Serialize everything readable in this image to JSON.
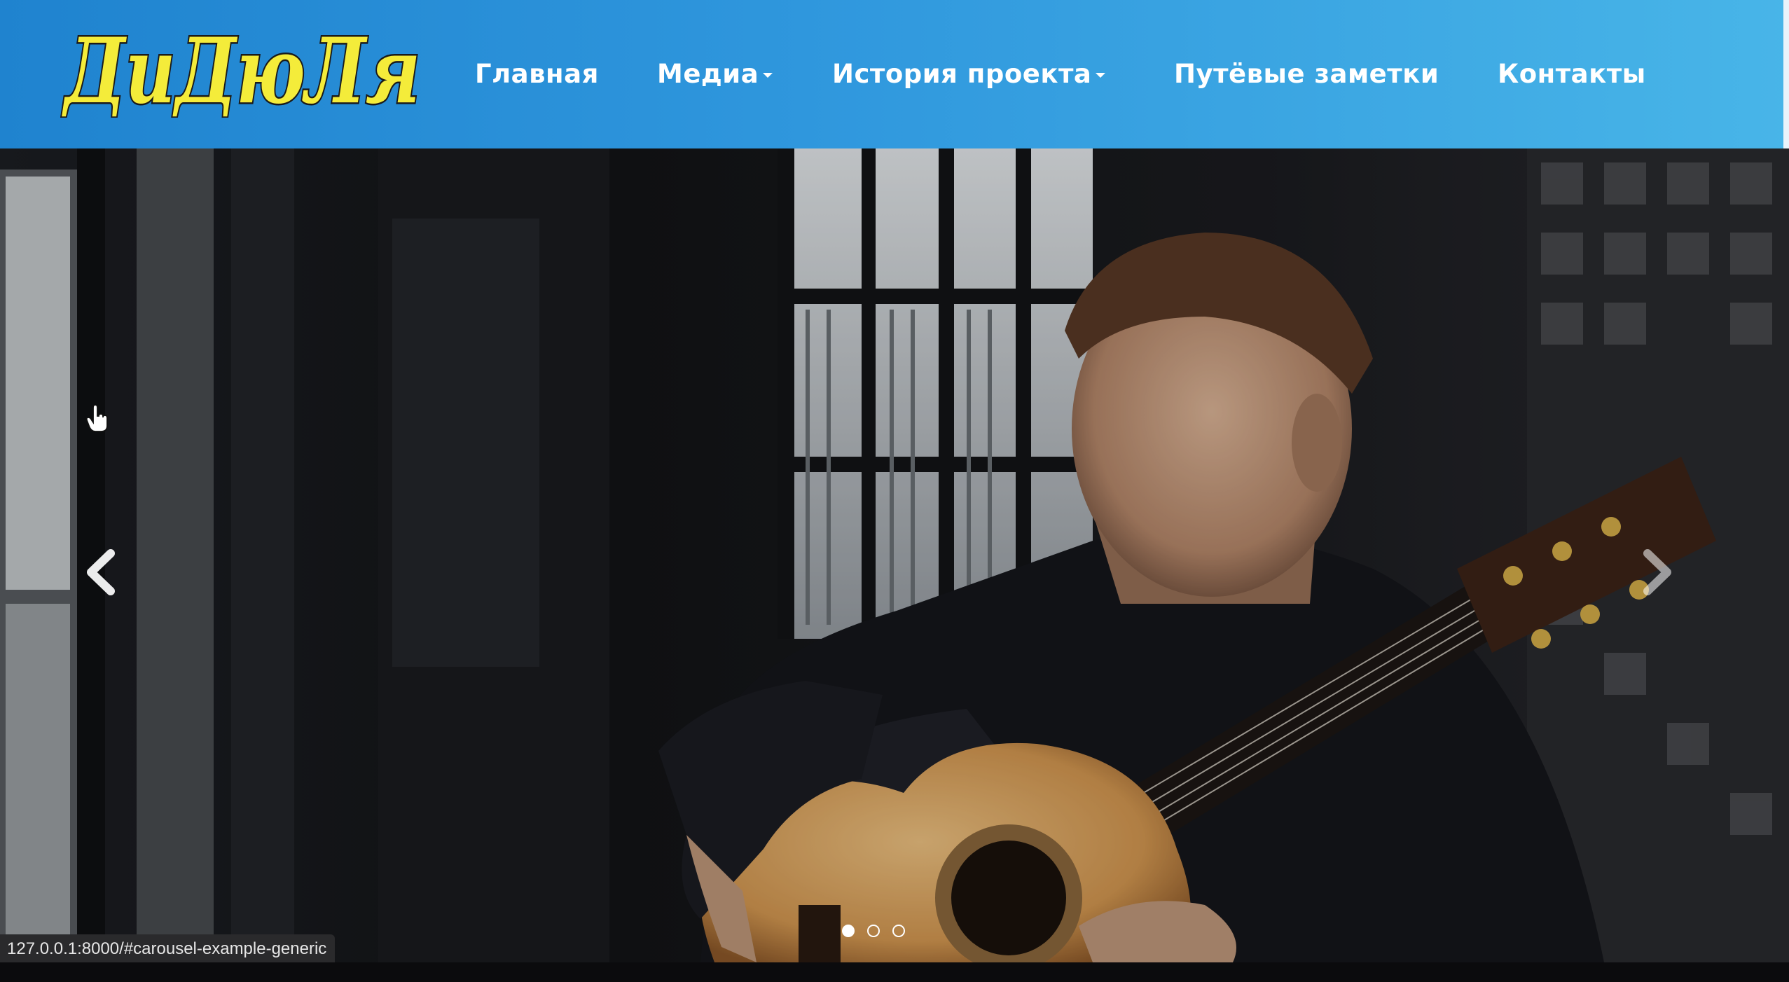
{
  "site": {
    "logo_text": "ДиДюЛя",
    "logo_colors": {
      "fill": "#f4ec3a",
      "outline": "#1a1a1a"
    },
    "nav_gradient": [
      "#1f83cf",
      "#48b5e8"
    ]
  },
  "nav": {
    "items": [
      {
        "label": "Главная",
        "dropdown": false
      },
      {
        "label": "Медиа",
        "dropdown": true
      },
      {
        "label": "История проекта",
        "dropdown": true
      },
      {
        "label": "Путёвые заметки",
        "dropdown": false
      },
      {
        "label": "Контакты",
        "dropdown": false
      }
    ]
  },
  "carousel": {
    "slide_description_icon": "guitarist-photo",
    "prev_icon": "chevron-left-icon",
    "next_icon": "chevron-right-icon",
    "indicator_count": 3,
    "active_indicator": 1
  },
  "status_bar": {
    "url": "127.0.0.1:8000/#carousel-example-generic"
  }
}
